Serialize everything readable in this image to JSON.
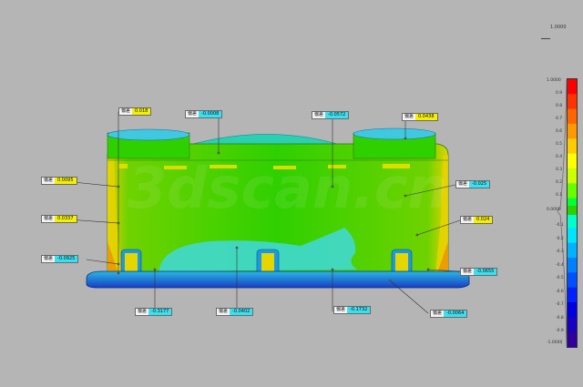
{
  "watermark": "3dscan.cn",
  "scale_bar": {
    "top_value": "1.0000",
    "max_label": "1.0000",
    "min_label": "-1.0000",
    "mid_label": "0.0000",
    "tick_labels": [
      "0.9",
      "0.8",
      "0.7",
      "0.6",
      "0.5",
      "0.4",
      "0.3",
      "0.2",
      "0.1",
      "-0.1",
      "-0.2",
      "-0.3",
      "-0.4",
      "-0.5",
      "-0.6",
      "-0.7",
      "-0.8",
      "-0.9"
    ],
    "colors": [
      "#ff0000",
      "#ff3300",
      "#ff6600",
      "#ff9900",
      "#ffcc00",
      "#ffff00",
      "#ccff00",
      "#66ff00",
      "#00ff33",
      "#00ffcc",
      "#00e5ff",
      "#00b2ff",
      "#0080ff",
      "#0050ff",
      "#0020ff",
      "#0000e0",
      "#1a00c0",
      "#30009a"
    ]
  },
  "callouts": [
    {
      "label": "偏差",
      "value": "0.018",
      "style": "yellow"
    },
    {
      "label": "偏差",
      "value": "-0.0008",
      "style": "cyan"
    },
    {
      "label": "偏差",
      "value": "-0.0572",
      "style": "cyan"
    },
    {
      "label": "偏差",
      "value": "0.0438",
      "style": "yellow"
    },
    {
      "label": "偏差",
      "value": "0.0095",
      "style": "yellow"
    },
    {
      "label": "偏差",
      "value": "-0.025",
      "style": "cyan"
    },
    {
      "label": "偏差",
      "value": "0.0337",
      "style": "yellow"
    },
    {
      "label": "偏差",
      "value": "0.024",
      "style": "yellow"
    },
    {
      "label": "偏差",
      "value": "-0.0925",
      "style": "cyan"
    },
    {
      "label": "偏差",
      "value": "-0.0655",
      "style": "cyan"
    },
    {
      "label": "偏差",
      "value": "-0.3177",
      "style": "cyan"
    },
    {
      "label": "偏差",
      "value": "-0.0402",
      "style": "cyan"
    },
    {
      "label": "偏差",
      "value": "-0.1732",
      "style": "cyan"
    },
    {
      "label": "偏差",
      "value": "-0.0064",
      "style": "cyan"
    }
  ]
}
